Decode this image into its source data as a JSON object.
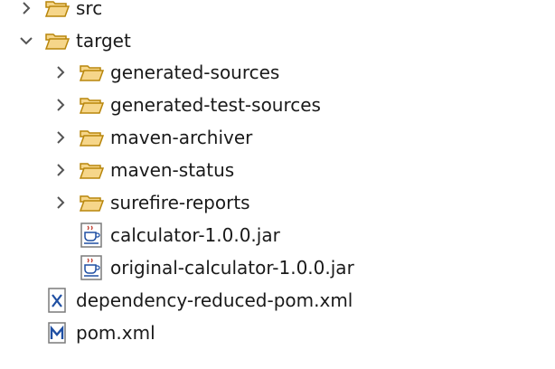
{
  "tree": {
    "items": [
      {
        "label": "src",
        "kind": "folder",
        "state": "collapsed",
        "depth": 0
      },
      {
        "label": "target",
        "kind": "folder",
        "state": "expanded",
        "depth": 0
      },
      {
        "label": "generated-sources",
        "kind": "folder",
        "state": "collapsed",
        "depth": 1
      },
      {
        "label": "generated-test-sources",
        "kind": "folder",
        "state": "collapsed",
        "depth": 1
      },
      {
        "label": "maven-archiver",
        "kind": "folder",
        "state": "collapsed",
        "depth": 1
      },
      {
        "label": "maven-status",
        "kind": "folder",
        "state": "collapsed",
        "depth": 1
      },
      {
        "label": "surefire-reports",
        "kind": "folder",
        "state": "collapsed",
        "depth": 1
      },
      {
        "label": "calculator-1.0.0.jar",
        "kind": "jar",
        "depth": 1
      },
      {
        "label": "original-calculator-1.0.0.jar",
        "kind": "jar",
        "depth": 1
      },
      {
        "label": "dependency-reduced-pom.xml",
        "kind": "xml",
        "depth": 0
      },
      {
        "label": "pom.xml",
        "kind": "maven-pom",
        "depth": 0
      }
    ]
  },
  "icons": {
    "chevron_collapsed": "chevron-right-icon",
    "chevron_expanded": "chevron-down-icon",
    "folder": "folder-open-icon",
    "jar": "jar-file-icon",
    "xml": "xml-file-icon",
    "maven_pom": "maven-pom-icon"
  },
  "colors": {
    "folder_fill": "#f6d68a",
    "folder_stroke": "#b8860b",
    "chevron": "#555555",
    "text": "#1a1a1a",
    "maven_blue": "#1f4fa3",
    "jar_accent": "#c0392b"
  }
}
